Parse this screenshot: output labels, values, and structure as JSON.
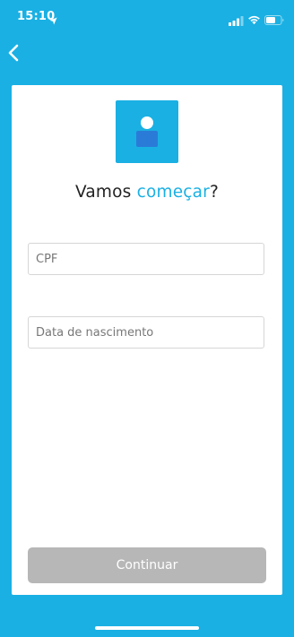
{
  "status_bar": {
    "time": "15:10",
    "icons": [
      "location-arrow-icon",
      "cellular-signal-icon",
      "wifi-icon",
      "battery-icon"
    ]
  },
  "navigation": {
    "back_icon": "chevron-left-icon"
  },
  "header": {
    "title_prefix": "Vamos ",
    "title_accent": "começar",
    "title_suffix": "?",
    "avatar_icon": "user-icon"
  },
  "form": {
    "cpf": {
      "placeholder": "CPF",
      "value": ""
    },
    "birth_date": {
      "placeholder": "Data de nascimento",
      "value": ""
    }
  },
  "actions": {
    "continue_label": "Continuar",
    "continue_enabled": false
  },
  "colors": {
    "background": "#1ab0e3",
    "accent": "#1ab0e3",
    "avatar_body": "#2a7bd8",
    "button_disabled": "#b7b7b7",
    "card": "#ffffff"
  }
}
